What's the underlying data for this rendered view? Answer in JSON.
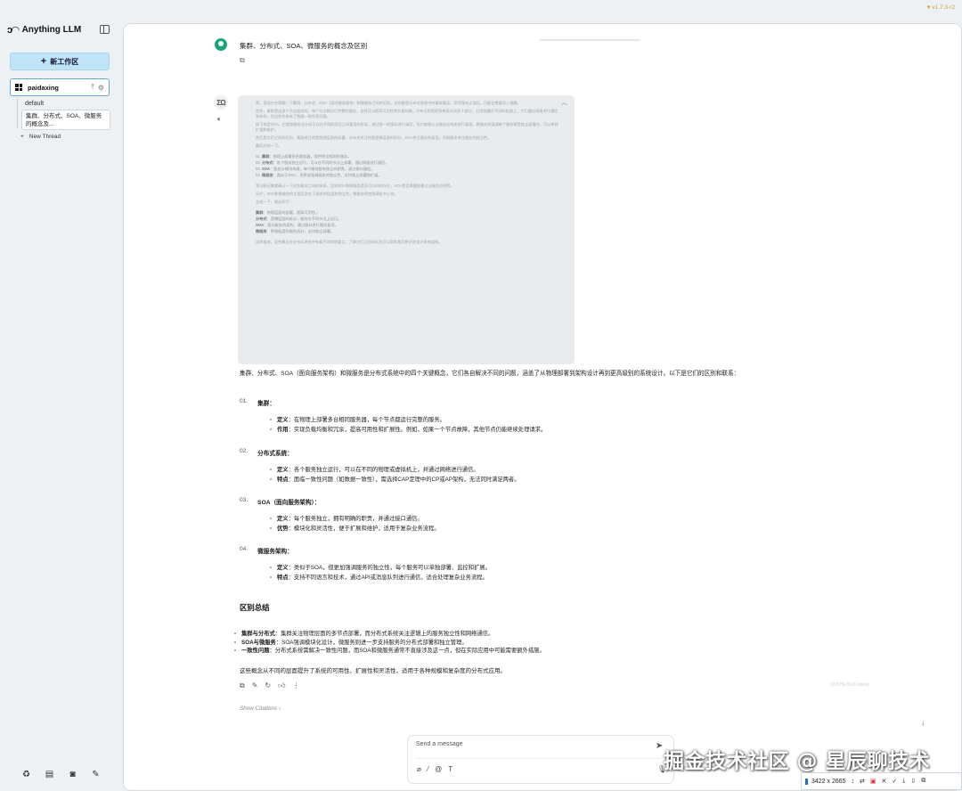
{
  "app": {
    "name": "Anything LLM",
    "logo_mark": "ↄ◠",
    "version": "v1.7.3-r2"
  },
  "sidebar": {
    "new_workspace_label": "新工作区",
    "workspace": {
      "name": "paidaxing"
    },
    "threads": [
      {
        "label": "default"
      },
      {
        "label": "集群、分布式、SOA、微服务的概念及..."
      }
    ],
    "new_thread_label": "New Thread"
  },
  "chat": {
    "user_message": "集群、分布式、SOA、微服务的概念及区别",
    "bot_avatar_text": "ΣΩ",
    "thought": {
      "paragraphs": [
        "嗯，我现在在理解一下集群、分布式、SOA（面向服务架构）和微服务之间的区别。这些都是分布式系统中的基本概念，然而我有点混乱，可能会需要深入理解。",
        "首先，集群是由多个节点组成的，每个节点都运行完整的服务，这样可以提高可用性和负载均衡。分布式则是把系统拆分成多个部分，分别部署在不同的机器上，它们通过网络进行通信和协作，但这样也带来了数据一致性等问题。",
        "接下来是SOA，它是把服务设计成可以在不同的项目之间重用的形式，通过统一的接口进行调用，但它依赖企业服务总线来进行管理。微服务则强调每个服务都是独立部署的，可以单独扩展和维护。",
        "然后是它们之间的区别，集群关注的是物理层面的部署，分布式关注的是逻辑层面的拆分，SOA关注服务的复用，而微服务关注服务的独立性。",
        "最后总结一下。"
      ],
      "list": [
        {
          "num": "01.",
          "title": "集群",
          "text": "物理上部署多台服务器，提供完全相同的服务。"
        },
        {
          "num": "02.",
          "title": "分布式",
          "text": "各个服务独立运行，可以在不同的节点上部署，通过网络进行通信。"
        },
        {
          "num": "03.",
          "title": "SOA",
          "text": "服务分模块构建，每个模块都有独立的职责，通过接口通信。"
        },
        {
          "num": "04.",
          "title": "微服务",
          "text": "类似于SOA，但更加强调服务的独立性，支持独立部署和扩展。"
        }
      ],
      "after": [
        "我可能还需要确认一下这些概念之间的关系，比如SOA和微服务是否可以同时存在，SOA是否需要依赖企业服务总线等。",
        "另外，SOA和微服务的主要区别在于服务的粒度和独立性，微服务更加强调去中心化。",
        "总结一下，概念如下："
      ],
      "summary": [
        {
          "title": "集群",
          "text": "物理层面的部署，提高可用性。"
        },
        {
          "title": "分布式",
          "text": "逻辑层面的拆分，服务在不同节点上运行。"
        },
        {
          "title": "SOA",
          "text": "面向服务的架构，通过接口进行服务复用。"
        },
        {
          "title": "微服务",
          "text": "更细粒度的服务拆分，支持独立部署。"
        }
      ],
      "ending": "这样看来，这些概念在分布式系统中有着不同的侧重点，了解它们之间的区别可以帮助我们更好地设计系统架构。"
    },
    "intro": "集群、分布式、SOA（面向服务架构）和微服务是分布式系统中的四个关键概念，它们各自解决不同的问题，涵盖了从物理部署到架构设计再到更高级别的系统设计。以下是它们的区别和联系：",
    "sections": [
      {
        "num": "01.",
        "title": "集群：",
        "items": [
          {
            "label": "定义",
            "text": "：在物理上部署多台相同服务器，每个节点都运行完整的服务。"
          },
          {
            "label": "作用",
            "text": "：实现负载均衡和冗余，提高可用性和扩展性。例如，如果一个节点故障，其他节点仍能继续处理请求。"
          }
        ]
      },
      {
        "num": "02.",
        "title": "分布式系统：",
        "items": [
          {
            "label": "定义",
            "text": "：各个服务独立运行，可以在不同的物理或虚拟机上，并通过网络进行通信。"
          },
          {
            "label": "特点",
            "text": "：面临一致性问题（如数据一致性），需选择CAP定理中的CP或AP架构，无法同时满足两者。"
          }
        ]
      },
      {
        "num": "03.",
        "title": "SOA（面向服务架构）：",
        "items": [
          {
            "label": "定义",
            "text": "：每个服务独立，拥有明确的职责，并通过接口通信。"
          },
          {
            "label": "优势",
            "text": "：模块化和灵活性，便于扩展和维护，适用于复杂业务流程。"
          }
        ]
      },
      {
        "num": "04.",
        "title": "微服务架构：",
        "items": [
          {
            "label": "定义",
            "text": "：类似于SOA，但更加强调服务的独立性，每个服务可以单独部署、监控和扩展。"
          },
          {
            "label": "特点",
            "text": "：支持不同语言和技术，通过API或消息队列进行通信，适合处理复杂业务流程。"
          }
        ]
      }
    ],
    "summary_title": "区别总结",
    "summary": [
      {
        "label": "集群与分布式",
        "text": "：集群关注物理层面的多节点部署，而分布式系统关注逻辑上的服务独立性和网络通信。"
      },
      {
        "label": "SOA与微服务",
        "text": "：SOA强调模块化设计，微服务则进一步支持服务的分布式部署和独立管理。"
      },
      {
        "label": "一致性问题",
        "text": "：分布式系统需解决一致性问题，而SOA和微服务通常不直接涉及这一点，但在实际应用中可能需要额外措施。"
      }
    ],
    "closing": "这些概念从不同的层面提升了系统的可用性、扩展性和灵活性，适用于各种规模和复杂度的分布式应用。",
    "meta": "03.87% (9.60 tok/s)",
    "citations_label": "Show Citations"
  },
  "composer": {
    "placeholder": "Send a message"
  },
  "watermark": "掘金技术社区 @ 星辰聊技术",
  "snip_tool": {
    "dimensions": "3422 x 2665"
  }
}
